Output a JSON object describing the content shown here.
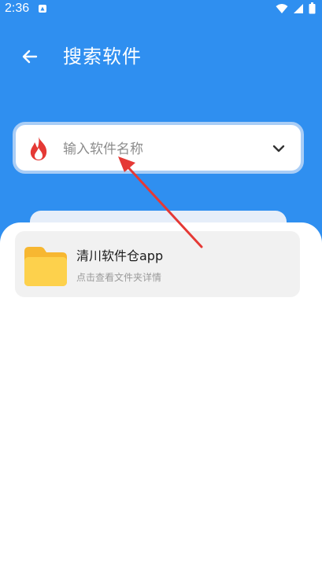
{
  "status_bar": {
    "time": "2:36",
    "icons": [
      "notification-icon",
      "wifi-icon",
      "cellular-icon",
      "battery-icon"
    ]
  },
  "header": {
    "title": "搜索软件",
    "back_icon": "arrow-left-icon"
  },
  "search": {
    "placeholder": "输入软件名称",
    "value": "",
    "leading_icon": "fire-icon",
    "trailing_icon": "chevron-down-icon"
  },
  "results": [
    {
      "name": "清川软件仓app",
      "description": "点击查看文件夹详情",
      "icon": "folder-icon"
    }
  ],
  "colors": {
    "primary": "#2f8ff0",
    "search_border": "#a9cdf6",
    "card_bg": "#f1f1f1",
    "folder": "#fdd14c",
    "fire": "#e53935",
    "annotation_arrow": "#e53935"
  }
}
